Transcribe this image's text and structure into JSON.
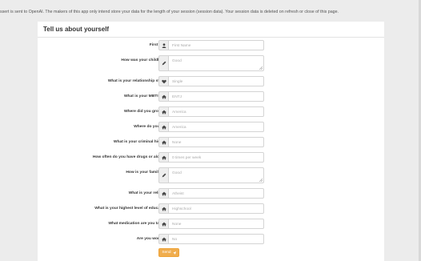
{
  "notice": "ssert is sent to OpenAI. The makers of this app only intend store your data for the length of your session (session data). Your session data is deleted on refresh or close of this page.",
  "panel_title": "Tell us about yourself",
  "fields": [
    {
      "id": "first-name",
      "label": "First Name",
      "placeholder": "First Name",
      "icon": "user-icon",
      "type": "input"
    },
    {
      "id": "childhood",
      "label": "How was your childhood?",
      "placeholder": "Good",
      "icon": "pencil-icon",
      "type": "textarea"
    },
    {
      "id": "relationship",
      "label": "What is your relationship status?",
      "placeholder": "Single",
      "icon": "heart-icon",
      "type": "input"
    },
    {
      "id": "mbti",
      "label": "What is your MBTI type?",
      "placeholder": "ENTJ",
      "icon": "home-icon",
      "type": "input"
    },
    {
      "id": "grow-up",
      "label": "Where did you grow up?",
      "placeholder": "America",
      "icon": "home-icon",
      "type": "input"
    },
    {
      "id": "live",
      "label": "Where do you live?",
      "placeholder": "America",
      "icon": "home-icon",
      "type": "input"
    },
    {
      "id": "criminal",
      "label": "What is your criminal history?",
      "placeholder": "None",
      "icon": "home-icon",
      "type": "input"
    },
    {
      "id": "drugs",
      "label": "How often do you have drugs or alcohol?",
      "placeholder": "0 times per week",
      "icon": "home-icon",
      "type": "input"
    },
    {
      "id": "family",
      "label": "How is your family life?",
      "placeholder": "Good",
      "icon": "pencil-icon",
      "type": "textarea"
    },
    {
      "id": "religion",
      "label": "What is your religion?",
      "placeholder": "Atheist",
      "icon": "home-icon",
      "type": "input"
    },
    {
      "id": "education",
      "label": "What is your highest level of education?",
      "placeholder": "Highschool",
      "icon": "home-icon",
      "type": "input"
    },
    {
      "id": "medication",
      "label": "What medication are you taking?",
      "placeholder": "None",
      "icon": "home-icon",
      "type": "input"
    },
    {
      "id": "working",
      "label": "Are you working?",
      "placeholder": "No",
      "icon": "home-icon",
      "type": "input"
    }
  ],
  "submit_label": "Send",
  "submit_icon": "send-icon",
  "colors": {
    "accent": "#f0ad4e",
    "background": "#ececec",
    "panel": "#ffffff"
  }
}
